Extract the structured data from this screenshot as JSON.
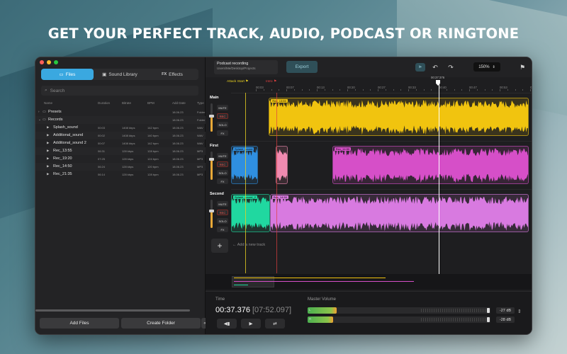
{
  "headline": "GET YOUR PERFECT TRACK, AUDIO, PODCAST OR RINGTONE",
  "colors": {
    "accent": "#3aa8e0",
    "yellow_track": "#f1c40f",
    "blue_clip": "#2f8fe0",
    "pink_clip": "#f08ab0",
    "magenta_clip": "#d64fc8",
    "teal_clip": "#20d8a0",
    "violet_clip": "#d87ae0",
    "playhead": "#ffffff",
    "attack_marker": "#e8d020",
    "red_marker": "#e04040"
  },
  "left_panel": {
    "tabs": [
      {
        "label": "Files",
        "icon": "file-icon",
        "active": true
      },
      {
        "label": "Sound Library",
        "icon": "library-icon",
        "active": false
      },
      {
        "label": "Effects",
        "icon": "fx-icon",
        "active": false
      }
    ],
    "search_placeholder": "Search",
    "columns": [
      "Name",
      "Duration",
      "Bitrate",
      "BPM",
      "Add Date",
      "Type"
    ],
    "rows": [
      {
        "name": "Presets",
        "kind": "folder",
        "expanded": false,
        "duration": "",
        "bitrate": "",
        "bpm": "",
        "date": "18.06.23",
        "type": "Folder"
      },
      {
        "name": "Records",
        "kind": "folder",
        "expanded": true,
        "duration": "",
        "bitrate": "",
        "bpm": "",
        "date": "18.06.23",
        "type": "Folder"
      },
      {
        "name": "Splash_sound",
        "kind": "file",
        "duration": "00:03",
        "bitrate": "1408 kbps",
        "bpm": "142 bpm",
        "date": "18.06.23",
        "type": "WAV"
      },
      {
        "name": "Additional_sound",
        "kind": "file",
        "duration": "00:02",
        "bitrate": "1408 kbps",
        "bpm": "140 bpm",
        "date": "18.06.23",
        "type": "WAV"
      },
      {
        "name": "Additional_sound 2",
        "kind": "file",
        "duration": "00:07",
        "bitrate": "1408 kbps",
        "bpm": "142 bpm",
        "date": "18.06.23",
        "type": "WAV"
      },
      {
        "name": "Rec_13:55",
        "kind": "file",
        "duration": "06:31",
        "bitrate": "128 kbps",
        "bpm": "128 bpm",
        "date": "18.06.23",
        "type": "MP3"
      },
      {
        "name": "Rec_19:20",
        "kind": "file",
        "duration": "07:25",
        "bitrate": "128 kbps",
        "bpm": "124 bpm",
        "date": "18.06.23",
        "type": "MP3"
      },
      {
        "name": "Rec_14:50",
        "kind": "file",
        "duration": "06:24",
        "bitrate": "128 kbps",
        "bpm": "120 bpm",
        "date": "18.06.23",
        "type": "MP3"
      },
      {
        "name": "Rec_21:35",
        "kind": "file",
        "duration": "06:14",
        "bitrate": "128 kbps",
        "bpm": "128 bpm",
        "date": "18.06.23",
        "type": "MP3"
      }
    ],
    "add_files_label": "Add Files",
    "create_folder_label": "Create Folder",
    "collapse_label": "«"
  },
  "toolbar": {
    "project_title": "Podcast recording",
    "project_path": "Users/Me/Desktop/Projects",
    "export_label": "Export",
    "zoom": "150%"
  },
  "timeline": {
    "playhead_time": "00:37:376",
    "ticks": [
      "00:03",
      "00:07",
      "00:13",
      "00:20",
      "00:27",
      "00:33",
      "00:40",
      "00:47",
      "00:53",
      "01:00"
    ],
    "markers": [
      {
        "label": "Attack Start",
        "color": "#e8d020"
      },
      {
        "label": "Intro",
        "color": "#e04040"
      }
    ]
  },
  "tracks": [
    {
      "name": "Main",
      "mute": "MUTE",
      "rec": "REC",
      "solo": "SOLO",
      "fx": "FX",
      "volume": 0.55,
      "clips": [
        {
          "label": "Rec_13:55",
          "color": "#f1c40f",
          "start": 0.06,
          "end": 1.0
        }
      ]
    },
    {
      "name": "First",
      "mute": "MUTE",
      "rec": "REC",
      "solo": "SOLO",
      "fx": "FX",
      "volume": 0.72,
      "clips": [
        {
          "label": "Splash_sound",
          "color": "#2f8fe0",
          "start": 0.0,
          "end": 0.09
        },
        {
          "label": "",
          "color": "#f08ab0",
          "start": 0.15,
          "end": 0.19
        },
        {
          "label": "Rec_14:50",
          "color": "#d64fc8",
          "start": 0.34,
          "end": 1.0
        }
      ]
    },
    {
      "name": "Second",
      "mute": "MUTE",
      "rec": "REC",
      "solo": "SOLO",
      "fx": "FX",
      "volume": 0.6,
      "clips": [
        {
          "label": "Splash_sound_2",
          "color": "#20d8a0",
          "start": 0.0,
          "end": 0.13
        },
        {
          "label": "Rec_14:50",
          "color": "#d87ae0",
          "start": 0.13,
          "end": 1.0
        }
      ]
    }
  ],
  "add_track_label": "Add a new track",
  "transport": {
    "time_label": "Time",
    "current_time": "00:37.376",
    "total_time": "[07:52.097]",
    "master_volume_label": "Master Volume",
    "channels": [
      {
        "name": "L",
        "level": 0.16,
        "db": "-27 dB"
      },
      {
        "name": "R",
        "level": 0.14,
        "db": "-28 dB"
      }
    ]
  }
}
